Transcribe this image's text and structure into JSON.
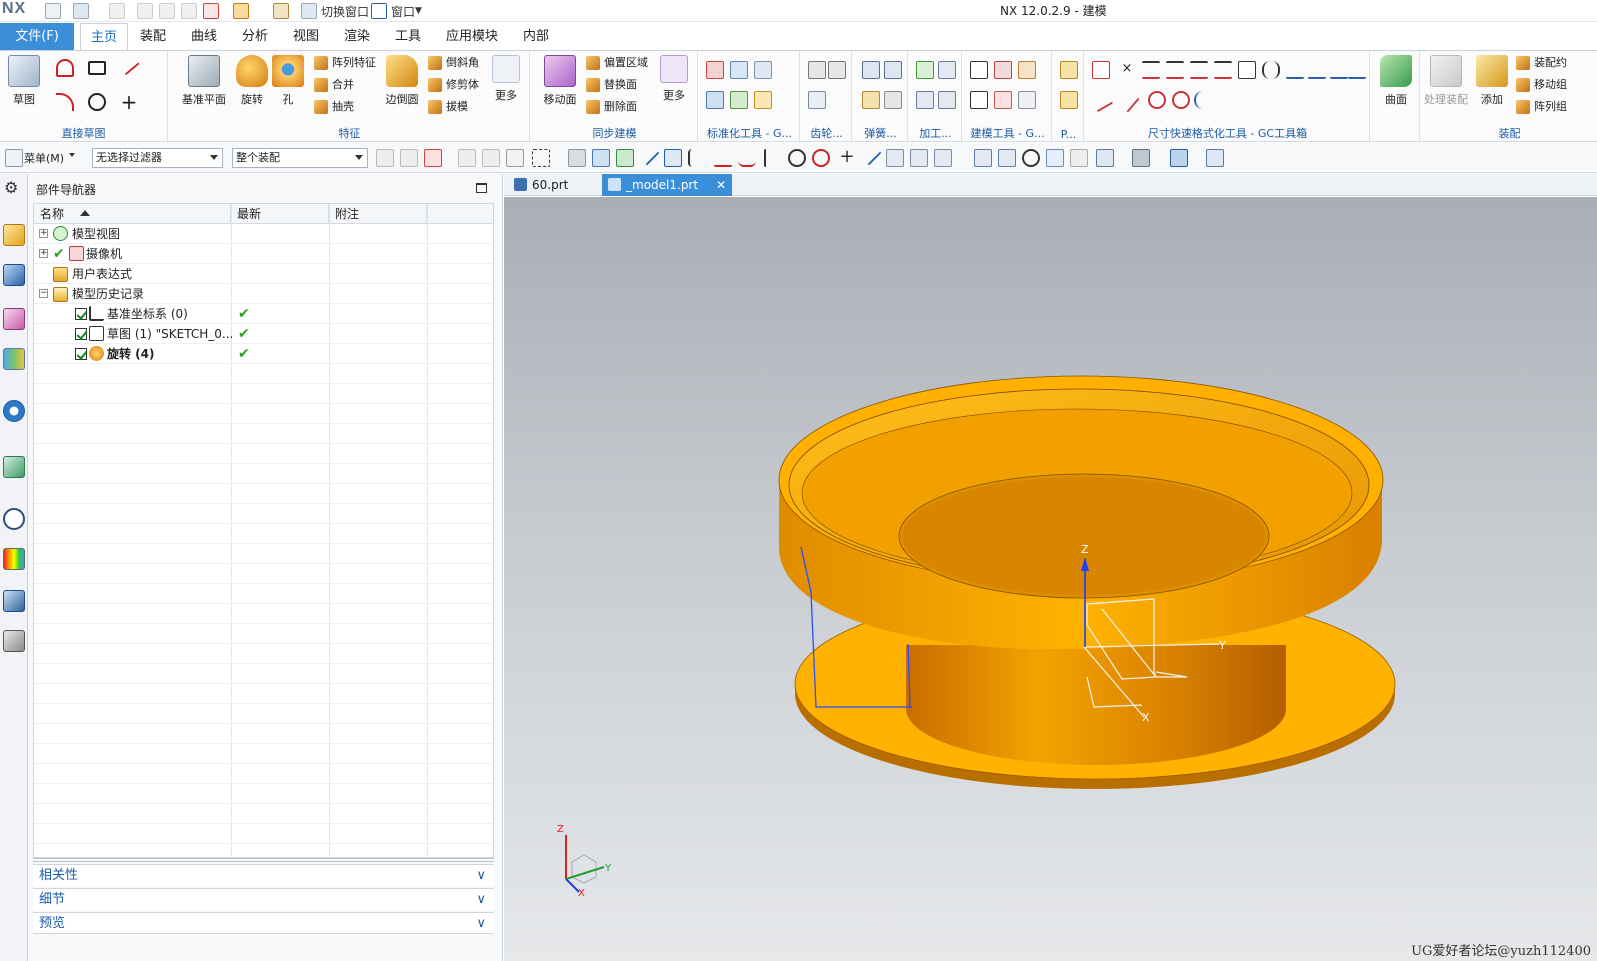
{
  "app": {
    "logo": "NX",
    "title": "NX 12.0.2.9 - 建模"
  },
  "quick_access": {
    "switch_window": "切换窗口",
    "window": "窗口"
  },
  "ribbon_tabs": [
    "文件(F)",
    "主页",
    "装配",
    "曲线",
    "分析",
    "视图",
    "渲染",
    "工具",
    "应用模块",
    "内部"
  ],
  "ribbon": {
    "direct_sketch": {
      "label": "直接草图",
      "sketch": "草图"
    },
    "feature": {
      "label": "特征",
      "datum_plane": "基准平面",
      "revolve": "旋转",
      "hole": "孔",
      "pattern": "阵列特征",
      "unite": "合并",
      "shell": "抽壳",
      "edge_blend": "边倒圆",
      "chamfer": "倒斜角",
      "trim_body": "修剪体",
      "draft": "拔模",
      "more": "更多"
    },
    "sync": {
      "label": "同步建模",
      "move_face": "移动面",
      "offset_region": "偏置区域",
      "replace_face": "替换面",
      "delete_face": "删除面",
      "more": "更多"
    },
    "std_tools": "标准化工具 - G...",
    "gear": "齿轮...",
    "spring": "弹簧...",
    "machining": "加工...",
    "modeling_tools": "建模工具 - G...",
    "p": "P...",
    "dim_tools": "尺寸快速格式化工具 - GC工具箱",
    "surface": "曲面",
    "assembly": {
      "label": "装配",
      "process": "处理装配",
      "add": "添加",
      "constraint": "装配约",
      "move": "移动组",
      "array": "阵列组"
    }
  },
  "toolbar": {
    "menu": "菜单(M)",
    "filter": "无选择过滤器",
    "scope": "整个装配"
  },
  "navigator": {
    "title": "部件导航器",
    "columns": [
      "名称",
      "最新",
      "附注"
    ],
    "tree": [
      {
        "label": "模型视图"
      },
      {
        "label": "摄像机"
      },
      {
        "label": "用户表达式"
      },
      {
        "label": "模型历史记录"
      },
      {
        "label": "基准坐标系 (0)"
      },
      {
        "label": "草图 (1) \"SKETCH_0..."
      },
      {
        "label": "旋转 (4)"
      }
    ],
    "panels": [
      "相关性",
      "细节",
      "预览"
    ]
  },
  "documents": [
    "60.prt",
    "_model1.prt"
  ],
  "viewport": {
    "axes": {
      "z": "Z",
      "y": "Y",
      "x": "X"
    },
    "watermark": "UG爱好者论坛@yuzh112400"
  },
  "colors": {
    "accent": "#3b8ed8",
    "part": "#f6a800",
    "ribbon_group": "#1b5aa8"
  }
}
